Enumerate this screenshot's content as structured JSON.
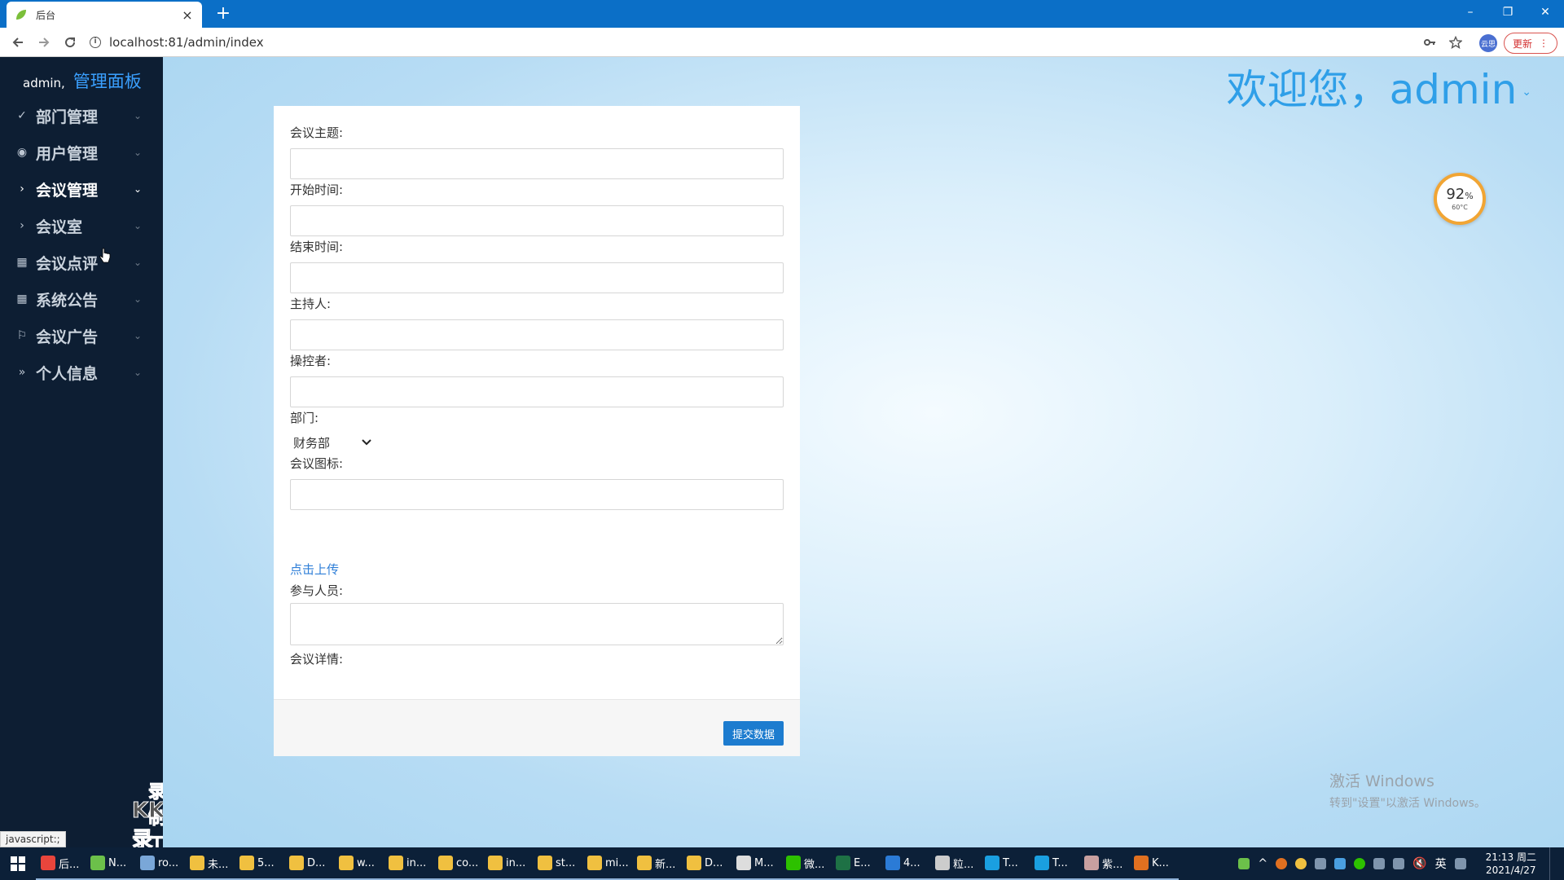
{
  "browser": {
    "tab_title": "后台",
    "close_glyph": "×",
    "newtab_glyph": "+",
    "url": "localhost:81/admin/index",
    "profile_label": "云思",
    "update_label": "更新",
    "win_minimize": "–",
    "win_restore": "❐",
    "win_close": "✕"
  },
  "sidebar": {
    "user": "admin,",
    "title": "管理面板",
    "items": [
      {
        "label": "部门管理",
        "icon": "check-icon",
        "glyph": "✓"
      },
      {
        "label": "用户管理",
        "icon": "radio-icon",
        "glyph": "◉"
      },
      {
        "label": "会议管理",
        "icon": "chevron-right-icon",
        "glyph": "›"
      },
      {
        "label": "会议室",
        "icon": "chevron-right-icon",
        "glyph": "›"
      },
      {
        "label": "会议点评",
        "icon": "grid-icon",
        "glyph": "▦"
      },
      {
        "label": "系统公告",
        "icon": "grid-icon",
        "glyph": "▦"
      },
      {
        "label": "会议广告",
        "icon": "flag-icon",
        "glyph": "⚐"
      },
      {
        "label": "个人信息",
        "icon": "double-chevron-icon",
        "glyph": "»"
      }
    ],
    "chevron_glyph": "⌄",
    "active_index": 2
  },
  "watermark": {
    "line1": "录制工具",
    "line2": "KK录像机"
  },
  "status_bar": "javascript:;",
  "header": {
    "welcome": "欢迎您，admin"
  },
  "gauge": {
    "percent": "92",
    "percent_sign": "%",
    "temp": "60°C"
  },
  "form": {
    "topic_label": "会议主题:",
    "start_label": "开始时间:",
    "end_label": "结束时间:",
    "host_label": "主持人:",
    "operator_label": "操控者:",
    "department_label": "部门:",
    "department_value": "财务部",
    "icon_label": "会议图标:",
    "upload_link": "点击上传",
    "participants_label": "参与人员:",
    "details_label": "会议详情:",
    "submit_label": "提交数据"
  },
  "activate": {
    "line1": "激活 Windows",
    "line2": "转到\"设置\"以激活 Windows。"
  },
  "taskbar": {
    "items": [
      {
        "label": "后...",
        "color": "#e8453c"
      },
      {
        "label": "N...",
        "color": "#6cc04a"
      },
      {
        "label": "ro...",
        "color": "#7aa7d8"
      },
      {
        "label": "未...",
        "color": "#f0c040"
      },
      {
        "label": "5...",
        "color": "#f0c040"
      },
      {
        "label": "D...",
        "color": "#f0c040"
      },
      {
        "label": "w...",
        "color": "#f0c040"
      },
      {
        "label": "in...",
        "color": "#f0c040"
      },
      {
        "label": "co...",
        "color": "#f0c040"
      },
      {
        "label": "in...",
        "color": "#f0c040"
      },
      {
        "label": "st...",
        "color": "#f0c040"
      },
      {
        "label": "mi...",
        "color": "#f0c040"
      },
      {
        "label": "新...",
        "color": "#f0c040"
      },
      {
        "label": "D...",
        "color": "#f0c040"
      },
      {
        "label": "M...",
        "color": "#dddddd"
      },
      {
        "label": "微...",
        "color": "#2dc100"
      },
      {
        "label": "E...",
        "color": "#1e7145"
      },
      {
        "label": "4...",
        "color": "#2b7bd6"
      },
      {
        "label": "粒...",
        "color": "#cccccc"
      },
      {
        "label": "T...",
        "color": "#1a9fe0"
      },
      {
        "label": "T...",
        "color": "#1a9fe0"
      },
      {
        "label": "紫...",
        "color": "#c8a0a0"
      },
      {
        "label": "K...",
        "color": "#e07020"
      }
    ],
    "ime": "英",
    "time": "21:13 周二",
    "date": "2021/4/27"
  }
}
